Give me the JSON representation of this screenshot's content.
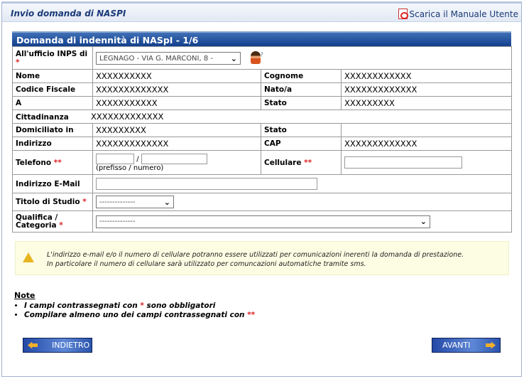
{
  "header": {
    "title": "Invio domanda di NASPI",
    "manual_link": "Scarica il Manuale Utente"
  },
  "form": {
    "title": "Domanda di indennità di NASpI - 1/6",
    "ufficio_label": "All'ufficio INPS di",
    "ufficio_value": "LEGNAGO - VIA G. MARCONI, 8 -",
    "nome_label": "Nome",
    "nome": "XXXXXXXXXX",
    "cognome_label": "Cognome",
    "cognome": "XXXXXXXXXXXX",
    "cf_label": "Codice Fiscale",
    "cf": "XXXXXXXXXXXXX",
    "nato_label": "Nato/a",
    "nato": "XXXXXXXXXXXXX",
    "a_label": "A",
    "a": "XXXXXXXXXXX",
    "stato_label": "Stato",
    "stato": "XXXXXXXXX",
    "cittadinanza_label": "Cittadinanza",
    "cittadinanza": "XXXXXXXXXXXXX",
    "domicilio_label": "Domiciliato in",
    "domicilio": "XXXXXXXXX",
    "stato2_label": "Stato",
    "stato2": "",
    "indirizzo_label": "Indirizzo",
    "indirizzo": "XXXXXXXXXXXXX",
    "cap_label": "CAP",
    "cap": "XXXXXXXXXXXXX",
    "telefono_label": "Telefono",
    "telefono_hint": "(prefisso / numero)",
    "slash": "/",
    "cellulare_label": "Cellulare",
    "email_label": "Indirizzo E-Mail",
    "titolo_label": "Titolo di Studio",
    "titolo_value": "--------------",
    "qualifica_label": "Qualifica / Categoria",
    "qualifica_value": "--------------",
    "req1": "*",
    "req2": "**"
  },
  "warning": {
    "line1": "L'indirizzo e-mail e/o il numero di cellulare potranno essere utilizzati per comunicazioni inerenti la domanda di prestazione.",
    "line2": "In particolare il numero di cellulare sarà utilizzato per comuncazioni automatiche tramite sms."
  },
  "notes": {
    "title": "Note",
    "item1_a": "I campi contrassegnati con ",
    "item1_b": " sono obbligatori",
    "item2": "Compilare almeno uno dei campi contrassegnati con "
  },
  "buttons": {
    "back": "INDIETRO",
    "next": "AVANTI"
  }
}
